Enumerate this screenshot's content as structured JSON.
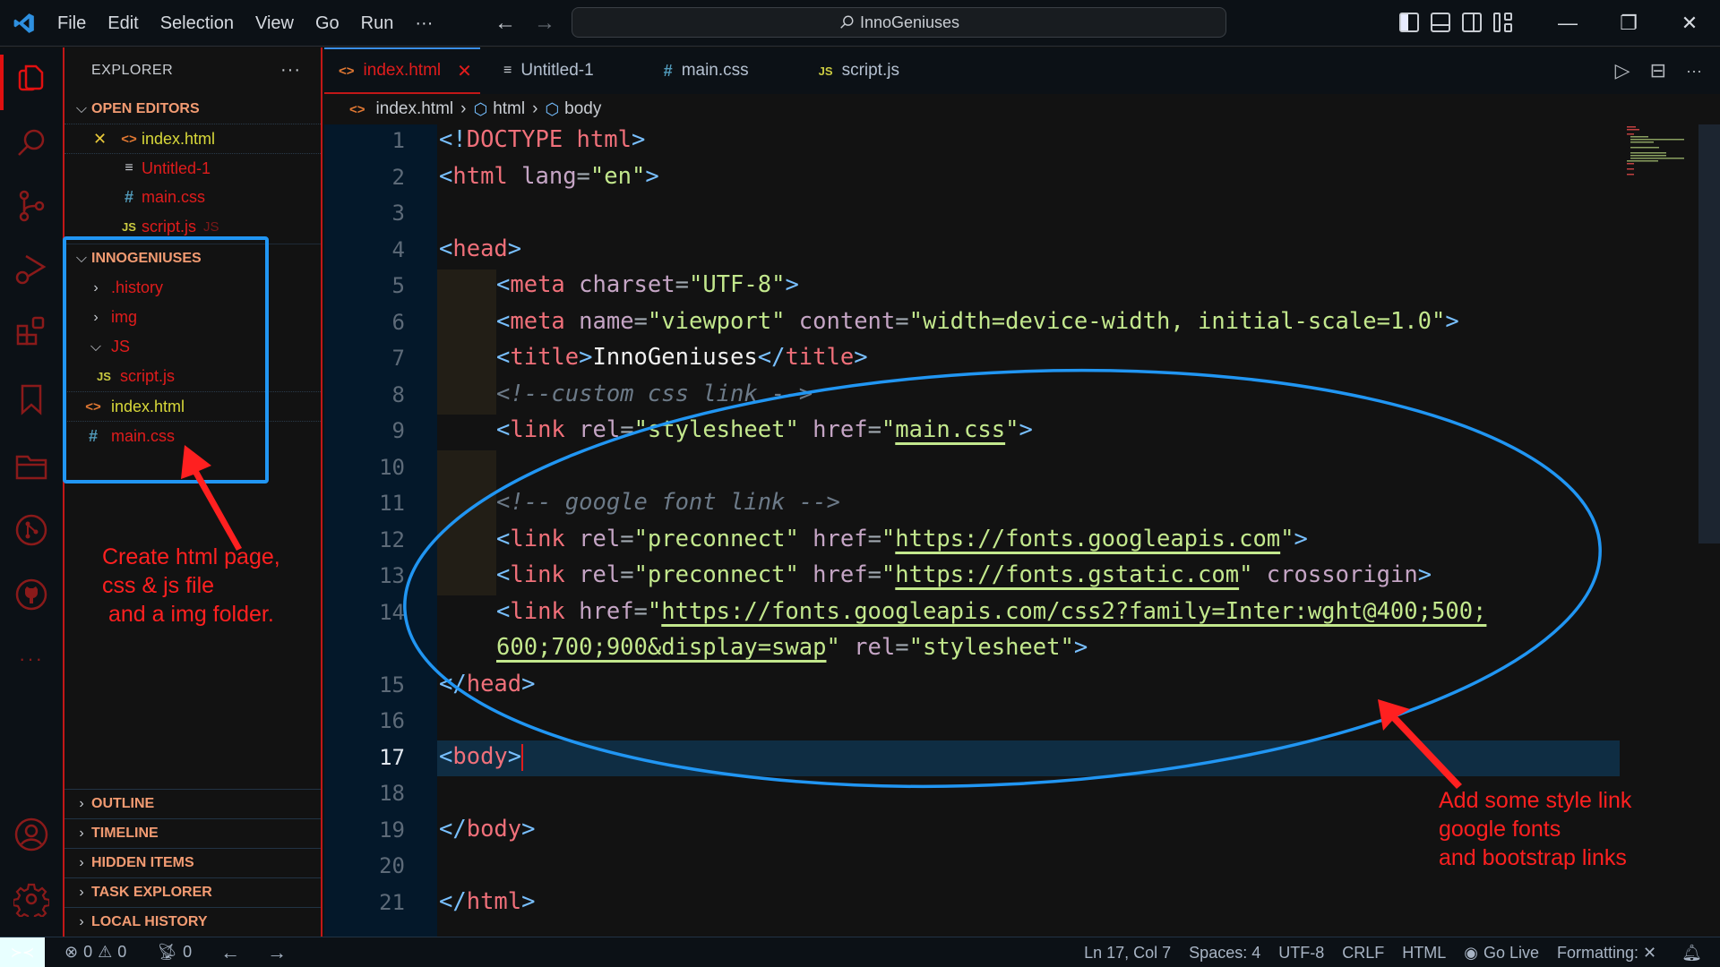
{
  "titlebar": {
    "menu": [
      "File",
      "Edit",
      "Selection",
      "View",
      "Go",
      "Run",
      "···"
    ],
    "search_text": "InnoGeniuses",
    "window_controls": [
      "minimize",
      "restore",
      "close"
    ]
  },
  "activity_bar": {
    "items": [
      "explorer",
      "search",
      "source-control",
      "run-debug",
      "extensions",
      "bookmarks",
      "project-manager",
      "git-graph",
      "github",
      "more",
      "accounts",
      "manage"
    ]
  },
  "sidebar": {
    "title": "EXPLORER",
    "more": "···",
    "open_editors": {
      "label": "OPEN EDITORS",
      "items": [
        {
          "name": "index.html",
          "icon": "html",
          "close": "✕",
          "color": "yellow"
        },
        {
          "name": "Untitled-1",
          "icon": "text",
          "color": "red"
        },
        {
          "name": "main.css",
          "icon": "css",
          "color": "red"
        },
        {
          "name": "script.js",
          "icon": "js",
          "color": "red",
          "suffix": "JS"
        }
      ]
    },
    "workspace": {
      "label": "INNOGENIUSES",
      "items": [
        {
          "name": ".history",
          "type": "folder",
          "expanded": false
        },
        {
          "name": "img",
          "type": "folder",
          "expanded": false
        },
        {
          "name": "JS",
          "type": "folder",
          "expanded": true
        },
        {
          "name": "script.js",
          "type": "js"
        },
        {
          "name": "index.html",
          "type": "html"
        },
        {
          "name": "main.css",
          "type": "css"
        }
      ]
    },
    "bottom_sections": [
      "OUTLINE",
      "TIMELINE",
      "HIDDEN ITEMS",
      "TASK EXPLORER",
      "LOCAL HISTORY"
    ]
  },
  "tabs": [
    {
      "label": "index.html",
      "icon": "html",
      "active": true,
      "close": "✕"
    },
    {
      "label": "Untitled-1",
      "icon": "text",
      "active": false
    },
    {
      "label": "main.css",
      "icon": "css",
      "active": false
    },
    {
      "label": "script.js",
      "icon": "js",
      "active": false
    }
  ],
  "breadcrumb": [
    "index.html",
    "html",
    "body"
  ],
  "editor": {
    "current_line": 17,
    "line_numbers": [
      "1",
      "2",
      "3",
      "4",
      "5",
      "6",
      "7",
      "8",
      "9",
      "10",
      "11",
      "12",
      "13",
      "14",
      "15",
      "16",
      "17",
      "18",
      "19",
      "20",
      "21"
    ],
    "lines": {
      "l1": [
        "<!",
        "DOCTYPE",
        " html",
        ">"
      ],
      "l2": [
        "<",
        "html",
        " lang",
        "=",
        "\"en\"",
        ">"
      ],
      "l4": [
        "<",
        "head",
        ">"
      ],
      "l5": [
        "<",
        "meta",
        " charset",
        "=",
        "\"UTF-8\"",
        ">"
      ],
      "l6": [
        "<",
        "meta",
        " name",
        "=",
        "\"viewport\"",
        " content",
        "=",
        "\"width=device-width, initial-scale=1.0\"",
        ">"
      ],
      "l7": [
        "<",
        "title",
        ">",
        "InnoGeniuses",
        "</",
        "title",
        ">"
      ],
      "l8": "<!--custom css link -->",
      "l9": [
        "<",
        "link",
        " rel",
        "=",
        "\"stylesheet\"",
        " href",
        "=",
        "\"",
        "main.css",
        "\"",
        ">"
      ],
      "l11": "<!-- google font link -->",
      "l12": [
        "<",
        "link",
        " rel",
        "=",
        "\"preconnect\"",
        " href",
        "=",
        "\"",
        "https://fonts.googleapis.com",
        "\"",
        ">"
      ],
      "l13": [
        "<",
        "link",
        " rel",
        "=",
        "\"preconnect\"",
        " href",
        "=",
        "\"",
        "https://fonts.gstatic.com",
        "\"",
        " crossorigin",
        ">"
      ],
      "l14a": [
        "<",
        "link",
        " href",
        "=",
        "\"",
        "https://fonts.googleapis.com/css2?family=Inter:wght@400;500;"
      ],
      "l14b": [
        "600;700;900&display=swap",
        "\"",
        " rel",
        "=",
        "\"stylesheet\"",
        ">"
      ],
      "l15": [
        "</",
        "head",
        ">"
      ],
      "l17": [
        "<",
        "body",
        ">"
      ],
      "l19": [
        "</",
        "body",
        ">"
      ],
      "l21": [
        "</",
        "html",
        ">"
      ]
    }
  },
  "annotations": {
    "left_note": "Create html page,\ncss & js file\n and a img folder.",
    "right_note": "Add some style link\ngoogle fonts\nand bootstrap links",
    "color": "#ff2020",
    "highlight_color": "#2196f3"
  },
  "statusbar": {
    "errors": "0",
    "warnings": "0",
    "ports": "0",
    "position": "Ln 17, Col 7",
    "spaces": "Spaces: 4",
    "encoding": "UTF-8",
    "eol": "CRLF",
    "language": "HTML",
    "go_live": "Go Live",
    "formatting": "Formatting: ✕"
  }
}
